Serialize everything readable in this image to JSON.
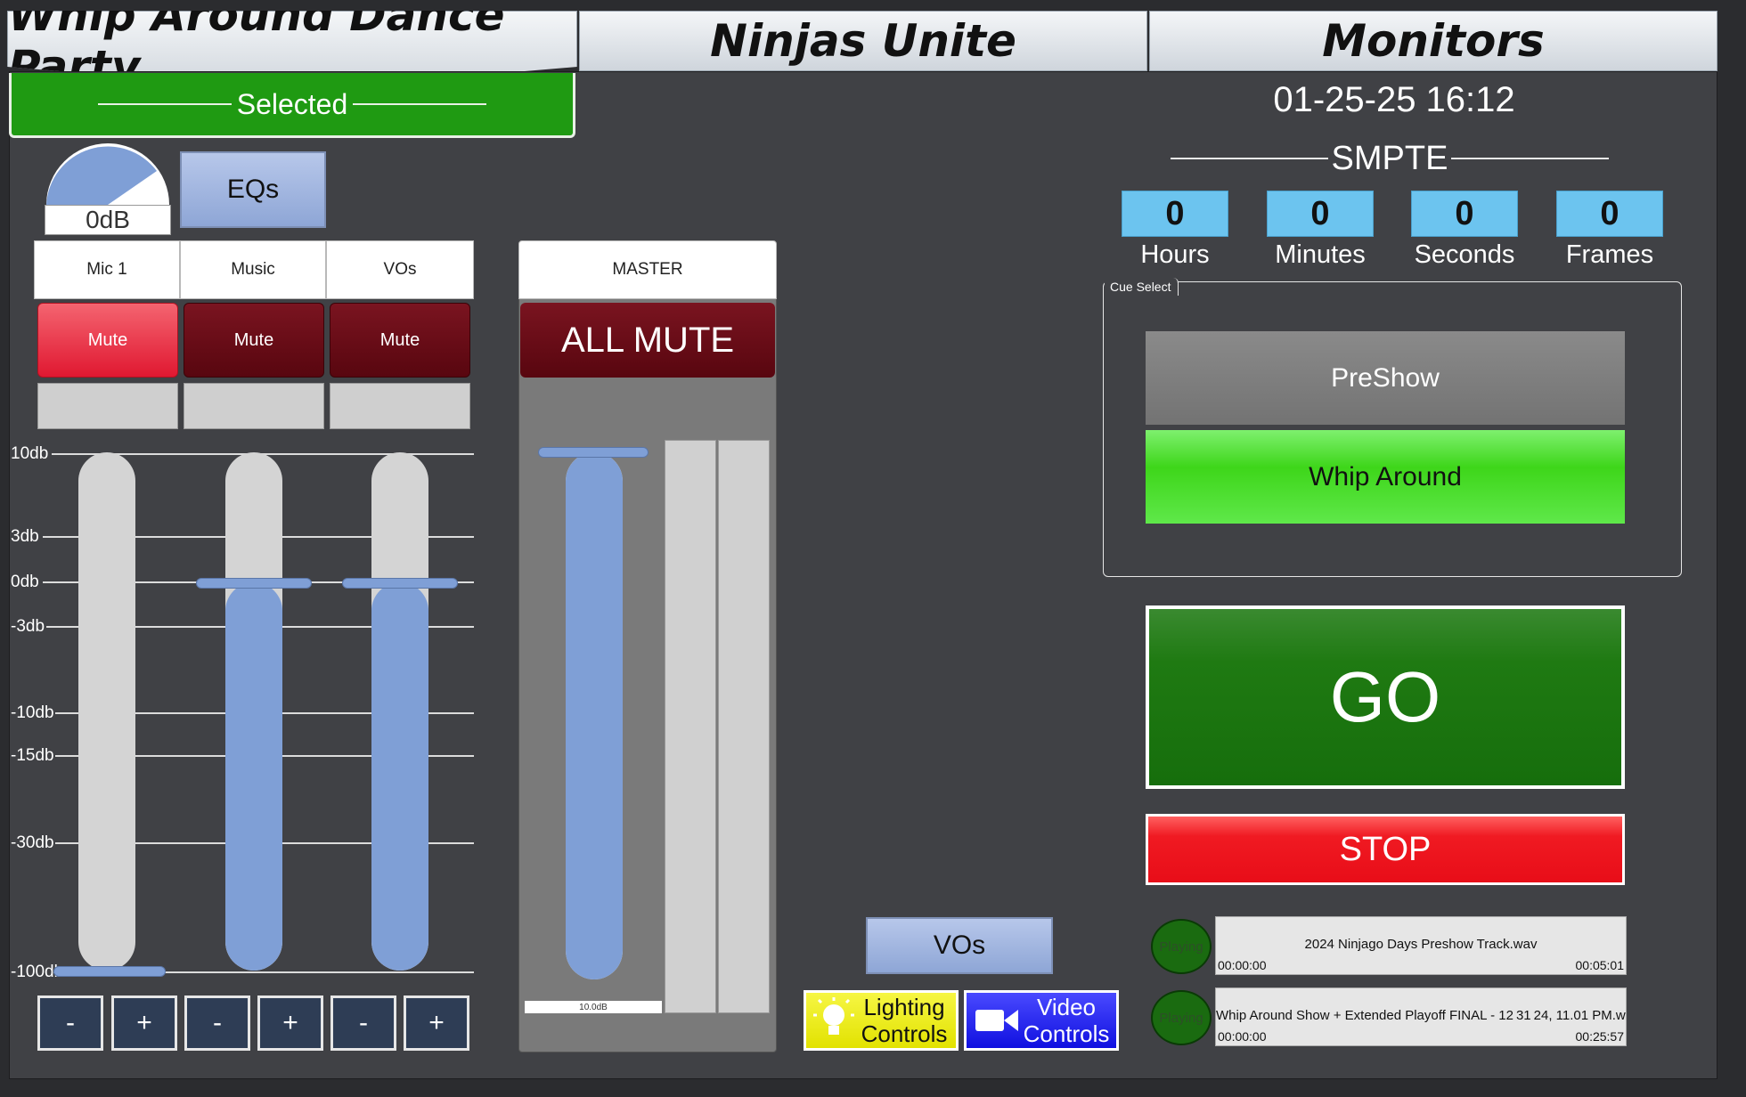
{
  "tabs": [
    {
      "label": "Whip Around Dance Party"
    },
    {
      "label": "Ninjas Unite"
    },
    {
      "label": "Monitors"
    }
  ],
  "selected_label": "Selected",
  "gain": {
    "readout": "0dB",
    "level": 0.7
  },
  "eqs_label": "EQs",
  "channels": [
    {
      "label": "Mic 1",
      "mute": "Mute",
      "muted": true,
      "level": 0.0
    },
    {
      "label": "Music",
      "mute": "Mute",
      "muted": false,
      "level": 0.75
    },
    {
      "label": "VOs",
      "mute": "Mute",
      "muted": false,
      "level": 0.75
    }
  ],
  "scale": [
    "10db",
    "3db",
    "0db",
    "-3db",
    "-10db",
    "-15db",
    "-30db",
    "-100db"
  ],
  "plus_minus": [
    "-",
    "+",
    "-",
    "+",
    "-",
    "+"
  ],
  "master": {
    "label": "MASTER",
    "all_mute": "ALL MUTE",
    "readout": "10.0dB",
    "level": 1.0
  },
  "vos_button": "VOs",
  "lighting_button": "Lighting Controls",
  "video_button": "Video Controls",
  "datetime": "01-25-25 16:12",
  "smpte": {
    "title": "SMPTE",
    "fields": [
      {
        "value": "0",
        "label": "Hours"
      },
      {
        "value": "0",
        "label": "Minutes"
      },
      {
        "value": "0",
        "label": "Seconds"
      },
      {
        "value": "0",
        "label": "Frames"
      }
    ]
  },
  "cue_select": {
    "legend": "Cue Select",
    "cues": [
      {
        "label": "PreShow",
        "active": false
      },
      {
        "label": "Whip Around",
        "active": true
      }
    ]
  },
  "go_label": "GO",
  "stop_label": "STOP",
  "players": [
    {
      "status": "Playing",
      "title": "2024 Ninjago Days Preshow Track.wav",
      "elapsed": "00:00:00",
      "duration": "00:05:01"
    },
    {
      "status": "Playing",
      "title": "Whip Around Show + Extended Playoff FINAL - 12 31 24, 11.01 PM.w",
      "elapsed": "00:00:00",
      "duration": "00:25:57"
    }
  ],
  "colors": {
    "go": "#1f7a12",
    "stop": "#f01a22",
    "selected": "#1f9a12",
    "fader": "#7f9fd6",
    "smpte_box": "#6cc4ef"
  }
}
